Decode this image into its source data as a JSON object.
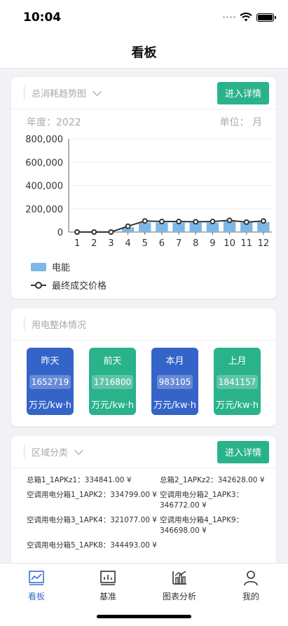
{
  "status": {
    "time": "10:04"
  },
  "nav": {
    "title": "看板"
  },
  "trend_card": {
    "title": "总消耗趋势图",
    "button": "进入详情",
    "year_label": "年度：2022",
    "unit_label": "单位：  月",
    "legend": {
      "bar": "电能",
      "line": "最终成交价格"
    }
  },
  "chart_data": {
    "type": "bar",
    "categories": [
      "1",
      "2",
      "3",
      "4",
      "5",
      "6",
      "7",
      "8",
      "9",
      "10",
      "11",
      "12"
    ],
    "series": [
      {
        "name": "电能",
        "type": "bar",
        "values": [
          0,
          0,
          0,
          40000,
          80000,
          80000,
          80000,
          80000,
          80000,
          90000,
          80000,
          85000
        ]
      },
      {
        "name": "最终成交价格",
        "type": "line",
        "values": [
          0,
          0,
          0,
          50000,
          95000,
          90000,
          90000,
          88000,
          90000,
          100000,
          85000,
          95000
        ]
      }
    ],
    "yticks": [
      "0",
      "200,000",
      "400,000",
      "600,000",
      "800,000"
    ],
    "ylim": [
      0,
      800000
    ],
    "colors": {
      "bar": "#7eb6e6",
      "line": "#333333"
    }
  },
  "usage_card": {
    "title": "用电整体情况",
    "stats": [
      {
        "label": "昨天",
        "value": "1652719",
        "unit": "万元/kw·h",
        "color": "#3464c8"
      },
      {
        "label": "前天",
        "value": "1716800",
        "unit": "万元/kw·h",
        "color": "#2ab28b"
      },
      {
        "label": "本月",
        "value": "983105",
        "unit": "万元/kw·h",
        "color": "#3464c8"
      },
      {
        "label": "上月",
        "value": "1841157",
        "unit": "万元/kw·h",
        "color": "#2ab28b"
      }
    ]
  },
  "region_card": {
    "title": "区域分类",
    "button": "进入详情",
    "items": [
      "总箱1_1APKz1：334841.00 ¥",
      "总箱2_1APKz2：342628.00 ¥",
      "空调用电分箱1_1APK2：334799.00 ¥",
      "空调用电分箱2_1APK3：346772.00 ¥",
      "空调用电分箱3_1APK4：321077.00 ¥",
      "空调用电分箱4_1APK9：346698.00 ¥",
      "空调用电分箱5_1APK8：344493.00 ¥"
    ]
  },
  "tabs": [
    {
      "label": "看板",
      "icon": "dashboard-icon",
      "active": true
    },
    {
      "label": "基准",
      "icon": "benchmark-icon",
      "active": false
    },
    {
      "label": "图表分析",
      "icon": "chart-analysis-icon",
      "active": false
    },
    {
      "label": "我的",
      "icon": "profile-icon",
      "active": false
    }
  ],
  "colors": {
    "accent": "#2ab28b",
    "blue": "#3464c8",
    "tab_active": "#3d6fd1"
  }
}
